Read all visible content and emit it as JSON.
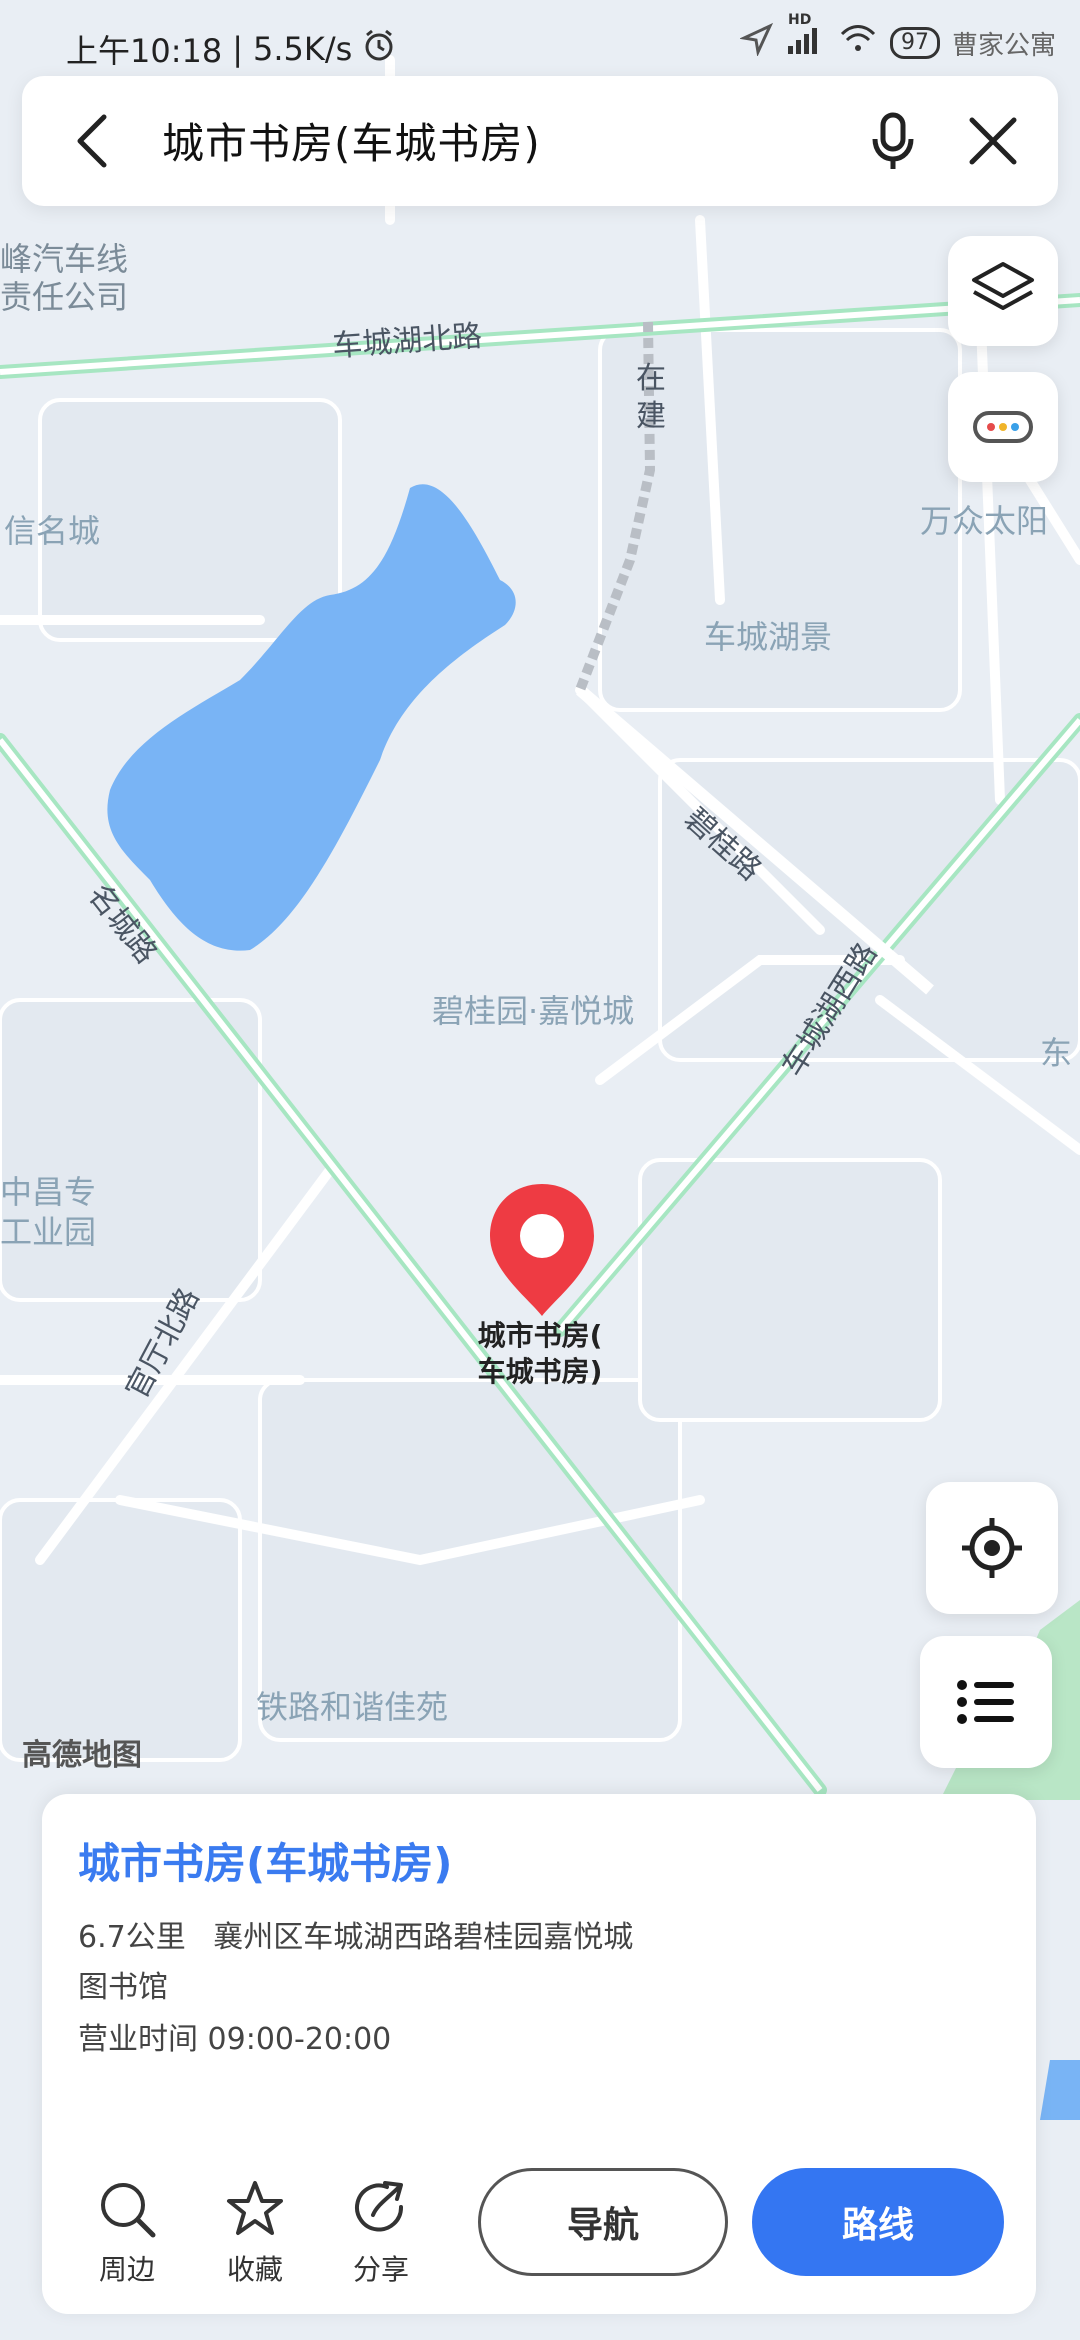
{
  "status_bar": {
    "time": "上午10:18",
    "speed": "5.5K/s",
    "battery": "97",
    "net_label": "HD",
    "overlay_text": "曹家公寓"
  },
  "search": {
    "query": "城市书房(车城书房)"
  },
  "map": {
    "labels": {
      "company": "峰汽车线\n责任公司",
      "xinming": "信名城",
      "wanzhong": "万众太阳",
      "chechenghujing": "车城湖景",
      "biguiyuan": "碧桂园·嘉悦城",
      "dong": "东",
      "changzhuan": "中昌专\n工业园",
      "tielu": "铁路和谐佳苑"
    },
    "roads": {
      "chechenghubeilu": "车城湖北路",
      "zaijian": "在建",
      "biguilu": "碧桂路",
      "chechenghuxilu": "车城湖西路",
      "mingchenglu": "名城路",
      "guantingbeilu": "官厅北路"
    },
    "watermark": "高德地图",
    "pin_label_line1": "城市书房(",
    "pin_label_line2": "车城书房)"
  },
  "card": {
    "title": "城市书房(车城书房)",
    "distance": "6.7公里",
    "address": "襄州区车城湖西路碧桂园嘉悦城",
    "category": "图书馆",
    "hours": "营业时间 09:00-20:00",
    "actions": {
      "nearby": "周边",
      "favorite": "收藏",
      "share": "分享"
    },
    "navigate_label": "导航",
    "route_label": "路线"
  },
  "colors": {
    "accent": "#3476f2",
    "title_blue": "#3a7bf0",
    "pin_red": "#ee3b43",
    "water": "#79b4f5",
    "road_green": "#a7e6c2"
  },
  "icons": [
    "back-icon",
    "mic-icon",
    "close-icon",
    "layers-icon",
    "more-icon",
    "locate-icon",
    "list-icon",
    "search-icon",
    "star-icon",
    "share-icon",
    "pin-icon",
    "alarm-icon",
    "location-arrow-icon",
    "signal-icon",
    "wifi-icon"
  ]
}
